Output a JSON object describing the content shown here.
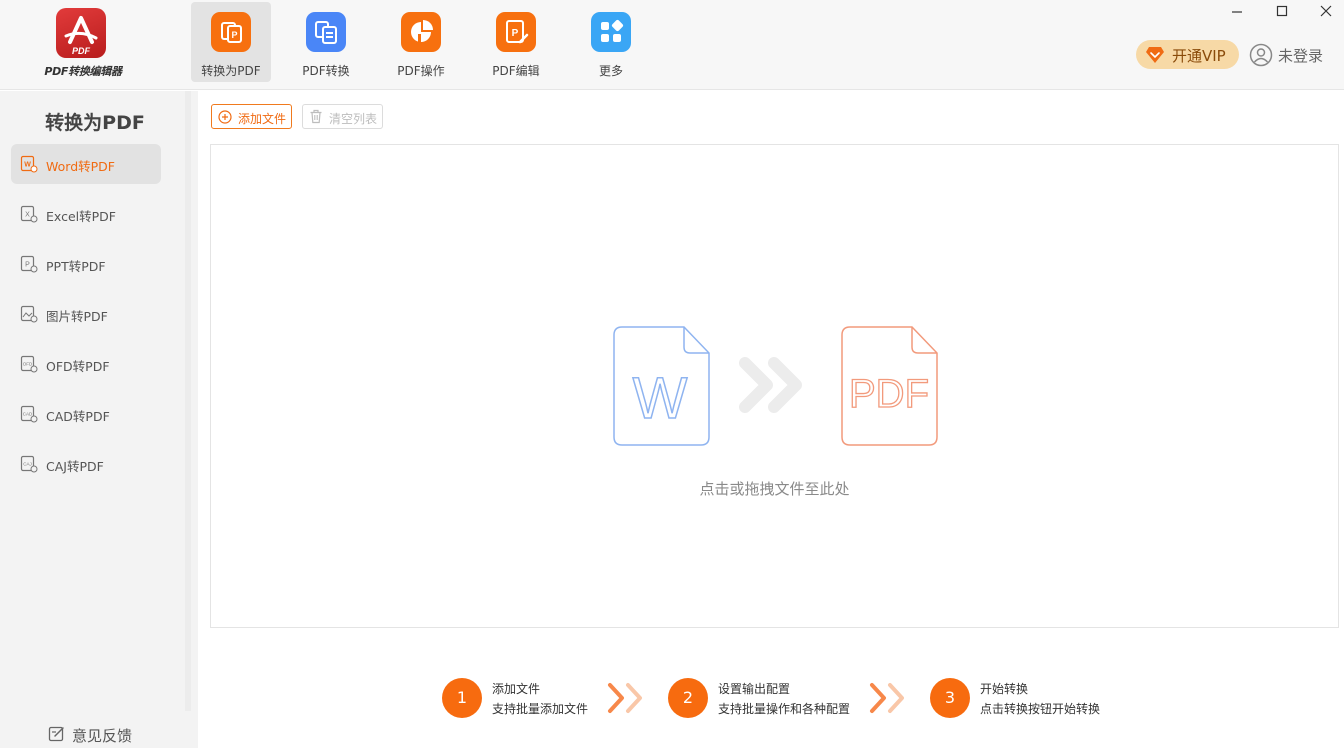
{
  "app": {
    "logo_text": "PDF转换编辑器",
    "logo_badge": "PDF"
  },
  "nav": {
    "items": [
      {
        "label": "转换为PDF",
        "icon": "convert-to-pdf-icon",
        "color": "#f7700f",
        "active": true
      },
      {
        "label": "PDF转换",
        "icon": "pdf-convert-icon",
        "color": "#4a86f7",
        "active": false
      },
      {
        "label": "PDF操作",
        "icon": "pdf-operate-icon",
        "color": "#f7700f",
        "active": false
      },
      {
        "label": "PDF编辑",
        "icon": "pdf-edit-icon",
        "color": "#f7700f",
        "active": false
      },
      {
        "label": "更多",
        "icon": "more-grid-icon",
        "color": "#3aa6f5",
        "active": false
      }
    ]
  },
  "header": {
    "vip_label": "开通VIP",
    "login_label": "未登录"
  },
  "sidebar": {
    "title": "转换为PDF",
    "items": [
      {
        "label": "Word转PDF",
        "icon": "word-file-icon",
        "active": true
      },
      {
        "label": "Excel转PDF",
        "icon": "excel-file-icon",
        "active": false
      },
      {
        "label": "PPT转PDF",
        "icon": "ppt-file-icon",
        "active": false
      },
      {
        "label": "图片转PDF",
        "icon": "image-file-icon",
        "active": false
      },
      {
        "label": "OFD转PDF",
        "icon": "ofd-file-icon",
        "active": false
      },
      {
        "label": "CAD转PDF",
        "icon": "cad-file-icon",
        "active": false
      },
      {
        "label": "CAJ转PDF",
        "icon": "caj-file-icon",
        "active": false
      }
    ],
    "feedback_label": "意见反馈"
  },
  "toolbar": {
    "add_label": "添加文件",
    "clear_label": "清空列表"
  },
  "drop_zone": {
    "hint": "点击或拖拽文件至此处",
    "source_letter": "W",
    "target_text": "PDF"
  },
  "steps": [
    {
      "number": "1",
      "title": "添加文件",
      "desc": "支持批量添加文件"
    },
    {
      "number": "2",
      "title": "设置输出配置",
      "desc": "支持批量操作和各种配置"
    },
    {
      "number": "3",
      "title": "开始转换",
      "desc": "点击转换按钮开始转换"
    }
  ],
  "colors": {
    "accent": "#f76b0f",
    "vip_bg": "#f7d9a6",
    "word_blue": "#8fb4f0",
    "pdf_orange": "#f29a7c"
  }
}
